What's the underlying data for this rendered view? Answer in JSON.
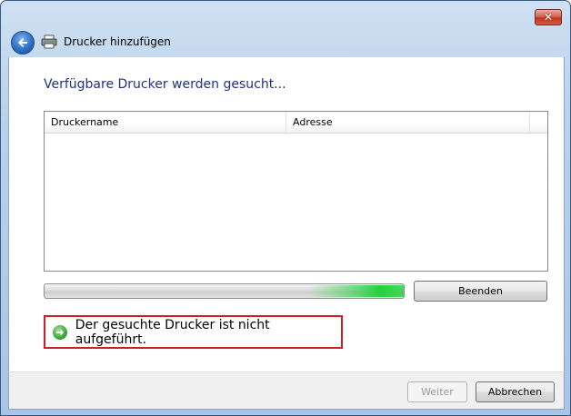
{
  "window": {
    "title": "Drucker hinzufügen",
    "close_label": "✕"
  },
  "main": {
    "heading": "Verfügbare Drucker werden gesucht...",
    "table": {
      "columns": [
        "Druckername",
        "Adresse"
      ],
      "rows": []
    },
    "progress_state": "indeterminate",
    "stop_button_label": "Beenden",
    "not_listed_link": "Der gesuchte Drucker ist nicht aufgeführt."
  },
  "footer": {
    "next_label": "Weiter",
    "cancel_label": "Abbrechen"
  },
  "icons": {
    "back": "back-arrow-icon",
    "printer": "printer-icon",
    "link_arrow": "green-arrow-icon",
    "close": "close-icon"
  },
  "colors": {
    "heading": "#1e3287",
    "link_highlight_border": "#cc1f1f",
    "progress_glow": "#25d23c"
  }
}
